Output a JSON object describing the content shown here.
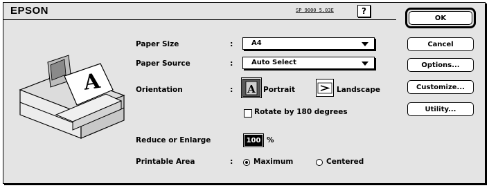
{
  "header": {
    "brand": "EPSON",
    "version": "SP 9000 5.03E",
    "help_label": "?"
  },
  "form": {
    "paper_size": {
      "label": "Paper Size",
      "value": "A4"
    },
    "paper_source": {
      "label": "Paper Source",
      "value": "Auto Select"
    },
    "orientation": {
      "label": "Orientation",
      "portrait_label": "Portrait",
      "landscape_label": "Landscape",
      "selected": "portrait"
    },
    "rotate": {
      "label": "Rotate by 180 degrees",
      "checked": false
    },
    "reduce_enlarge": {
      "label": "Reduce or Enlarge",
      "value": "100",
      "unit": "%"
    },
    "printable_area": {
      "label": "Printable Area",
      "options": [
        "Maximum",
        "Centered"
      ],
      "selected": "Maximum"
    }
  },
  "buttons": {
    "ok": "OK",
    "cancel": "Cancel",
    "options": "Options...",
    "customize": "Customize...",
    "utility": "Utility..."
  },
  "icons": {
    "printer": "printer-illustration-icon",
    "portrait": "portrait-orientation-icon",
    "landscape": "landscape-orientation-icon",
    "help": "help-icon",
    "popup_arrow": "chevron-down-icon"
  },
  "colors": {
    "dialog_bg": "#e4e4e4",
    "field_bg": "#ffffff",
    "selected_field": "#000000"
  }
}
